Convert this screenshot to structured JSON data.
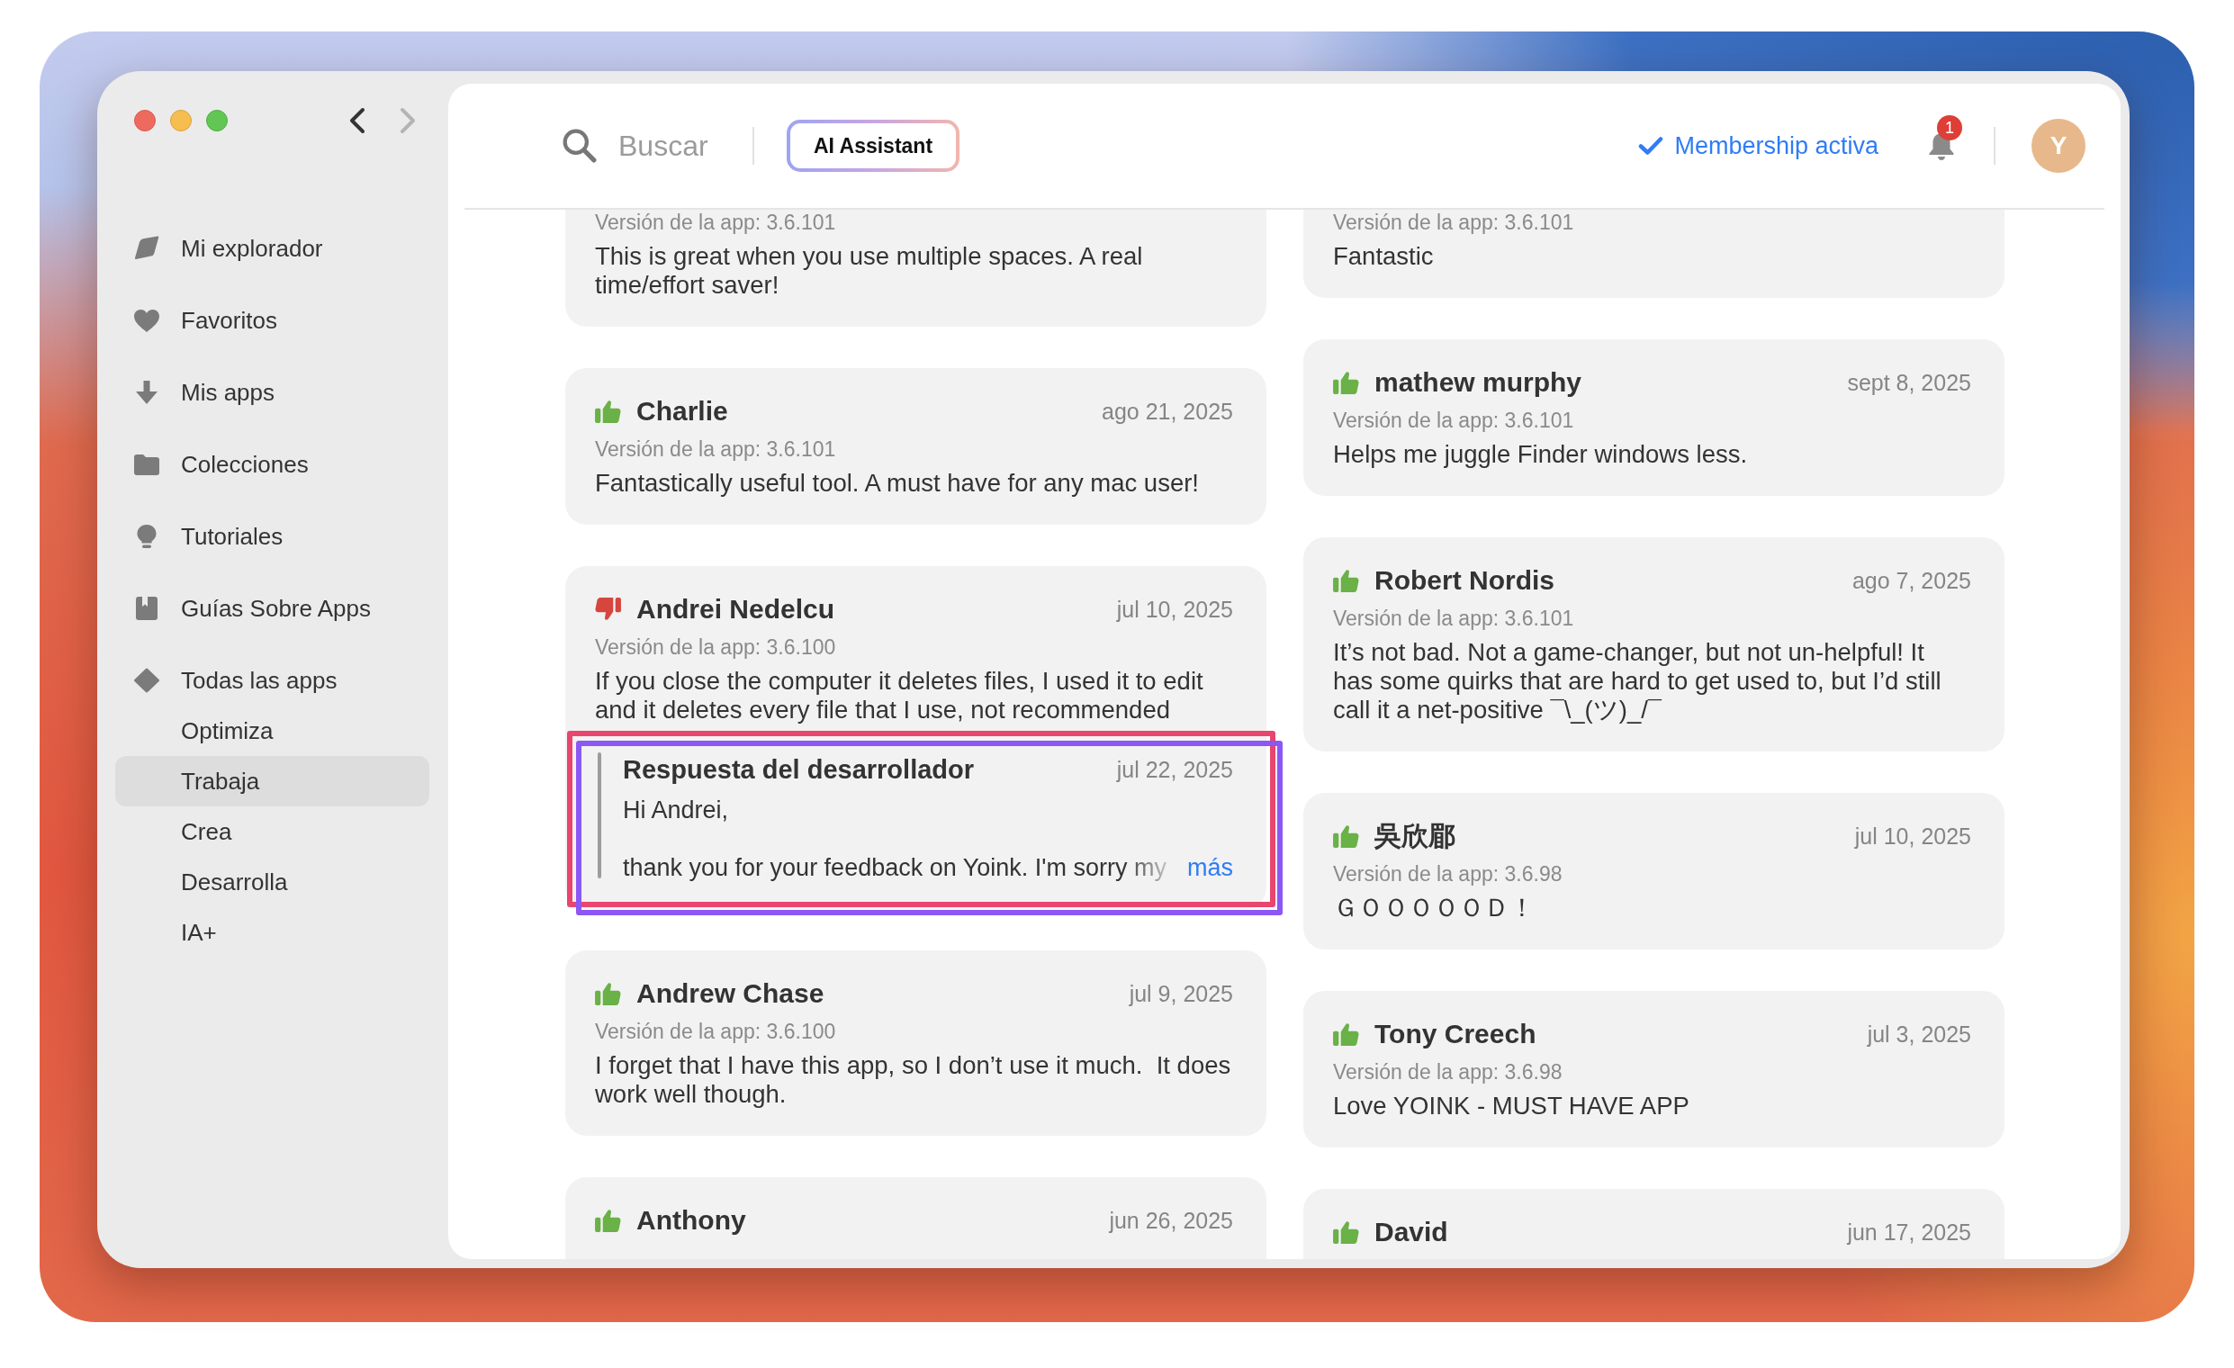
{
  "window": {
    "nav_buttons": [
      {
        "kind": "back",
        "disabled": false
      },
      {
        "kind": "forward",
        "disabled": true
      }
    ]
  },
  "sidebar": {
    "items": [
      {
        "label": "Mi explorador",
        "selected": false
      },
      {
        "label": "Favoritos",
        "selected": false
      },
      {
        "label": "Mis apps",
        "selected": false
      },
      {
        "label": "Colecciones",
        "selected": false
      },
      {
        "label": "Tutoriales",
        "selected": false
      },
      {
        "label": "Guías Sobre Apps",
        "selected": false
      },
      {
        "label": "Todas las apps",
        "selected": false,
        "children": [
          {
            "label": "Optimiza",
            "selected": false
          },
          {
            "label": "Trabaja",
            "selected": true
          },
          {
            "label": "Crea",
            "selected": false
          },
          {
            "label": "Desarrolla",
            "selected": false
          },
          {
            "label": "IA+",
            "selected": false
          }
        ]
      }
    ]
  },
  "header": {
    "search": {
      "placeholder": "Buscar"
    },
    "ai_button": {
      "label": "AI Assistant"
    },
    "membership": {
      "label": "Membership activa"
    },
    "notifications": {
      "badge": "1"
    },
    "avatar": {
      "initial": "Y"
    }
  },
  "review_columns": [
    {
      "reviews": [
        {
          "app_version": "Versión de la app: 3.6.101",
          "text": "This is great when you use multiple spaces. A real time/effort saver!"
        },
        {
          "positive": true,
          "author": "Charlie",
          "date": "ago 21, 2025",
          "app_version": "Versión de la app: 3.6.101",
          "text": "Fantastically useful tool. A must have for any mac user!"
        },
        {
          "positive": false,
          "author": "Andrei Nedelcu",
          "date": "jul 10, 2025",
          "app_version": "Versión de la app: 3.6.100",
          "text": "If you close the computer it deletes files, I used it to edit and it deletes every file that I use, not recommended",
          "developer_reply": {
            "title": "Respuesta del desarrollador",
            "date": "jul 22, 2025",
            "text": "Hi Andrei,\n\nthank you for your feedback on Yoink. I'm sorry my",
            "more_link": "más",
            "annotations": [
              {
                "color": "#e8466f"
              },
              {
                "color": "#8b57f5"
              }
            ]
          }
        },
        {
          "positive": true,
          "author": "Andrew Chase",
          "date": "jul 9, 2025",
          "app_version": "Versión de la app: 3.6.100",
          "text": "I forget that I have this app, so I don’t use it much.  It does work well though."
        },
        {
          "positive": true,
          "author": "Anthony",
          "date": "jun 26, 2025"
        }
      ]
    },
    {
      "reviews": [
        {
          "app_version": "Versión de la app: 3.6.101",
          "text": "Fantastic"
        },
        {
          "positive": true,
          "author": "mathew murphy",
          "date": "sept 8, 2025",
          "app_version": "Versión de la app: 3.6.101",
          "text": "Helps me juggle Finder windows less."
        },
        {
          "positive": true,
          "author": "Robert Nordis",
          "date": "ago 7, 2025",
          "app_version": "Versión de la app: 3.6.101",
          "text": "It’s not bad. Not a game-changer, but not un-helpful! It has some quirks that are hard to get used to, but I’d still call it a net-positive ¯\\_(ツ)_/¯"
        },
        {
          "positive": true,
          "author": "吳欣郿",
          "date": "jul 10, 2025",
          "app_version": "Versión de la app: 3.6.98",
          "text": "ＧＯＯＯＯＯＤ！"
        },
        {
          "positive": true,
          "author": "Tony Creech",
          "date": "jul 3, 2025",
          "app_version": "Versión de la app: 3.6.98",
          "text": "Love YOINK - MUST HAVE APP"
        },
        {
          "positive": true,
          "author": "David",
          "date": "jun 17, 2025"
        }
      ]
    }
  ]
}
